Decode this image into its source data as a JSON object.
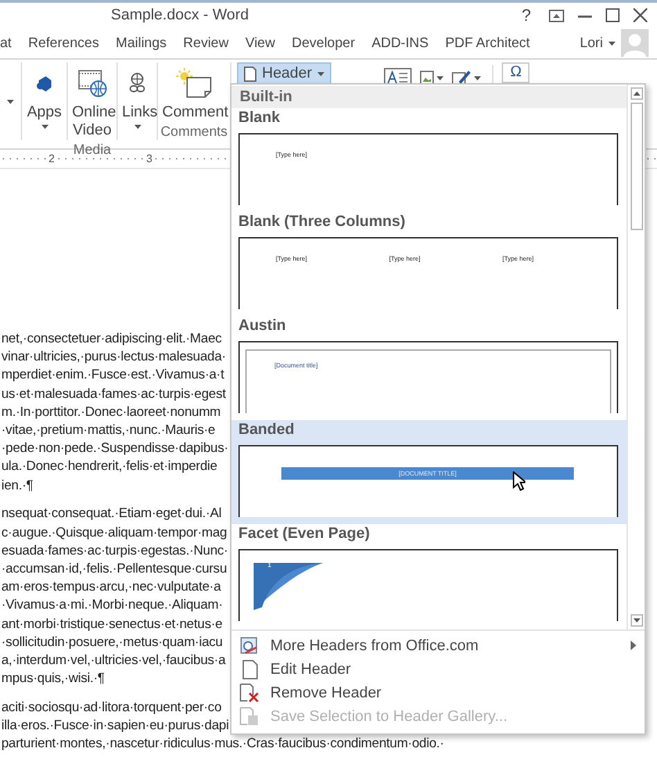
{
  "window": {
    "title": "Sample.docx - Word",
    "help": "?"
  },
  "tabs": [
    {
      "label": "at",
      "selected": false
    },
    {
      "label": "References",
      "selected": false
    },
    {
      "label": "Mailings",
      "selected": false
    },
    {
      "label": "Review",
      "selected": false
    },
    {
      "label": "View",
      "selected": false
    },
    {
      "label": "Developer",
      "selected": false
    },
    {
      "label": "ADD-INS",
      "selected": false
    },
    {
      "label": "PDF Architect",
      "selected": false
    }
  ],
  "account": {
    "name": "Lori"
  },
  "ribbon": {
    "groups": [
      {
        "buttons": [
          {
            "label": "Apps",
            "dropdown": true
          }
        ]
      },
      {
        "label": "Media",
        "buttons": [
          {
            "label": "Online Video",
            "dropdown": false
          }
        ]
      },
      {
        "buttons": [
          {
            "label": "Links",
            "dropdown": true
          }
        ]
      },
      {
        "label": "Comments",
        "buttons": [
          {
            "label": "Comment",
            "dropdown": false
          }
        ]
      }
    ],
    "header_button": {
      "label": "Header",
      "open": true
    },
    "symbol_button": {
      "label": "Ω"
    }
  },
  "ruler": {
    "marks": [
      "2",
      "3"
    ]
  },
  "document": {
    "paragraphs": [
      [
        "net,·consectetuer·adipiscing·elit.·Maec",
        "vinar·ultricies,·purus·lectus·malesuada·",
        "mperdiet·enim.·Fusce·est.·Vivamus·a·t",
        "us·et·malesuada·fames·ac·turpis·egest",
        "m.·In·porttitor.·Donec·laoreet·nonumm",
        "·vitae,·pretium·mattis,·nunc.·Mauris·e",
        "·pede·non·pede.·Suspendisse·dapibus·",
        "ula.·Donec·hendrerit,·felis·et·imperdie",
        "ien.·¶"
      ],
      [
        "nsequat·consequat.·Etiam·eget·dui.·Al",
        "c·augue.·Quisque·aliquam·tempor·mag",
        "esuada·fames·ac·turpis·egestas.·Nunc·",
        "·accumsan·id,·felis.·Pellentesque·cursu",
        "am·eros·tempus·arcu,·nec·vulputate·a",
        "·Vivamus·a·mi.·Morbi·neque.·Aliquam·",
        "ant·morbi·tristique·senectus·et·netus·e",
        "·sollicitudin·posuere,·metus·quam·iacu",
        "a,·interdum·vel,·ultricies·vel,·faucibus·a",
        "mpus·quis,·wisi.·¶"
      ],
      [
        "aciti·sociosqu·ad·litora·torquent·per·co",
        "illa·eros.·Fusce·in·sapien·eu·purus·dapi",
        "parturient·montes,·nascetur·ridiculus·mus.·Cras·faucibus·condimentum·odio.·"
      ]
    ]
  },
  "header_menu": {
    "section": "Built-in",
    "gallery": [
      {
        "name": "Blank",
        "kind": "blank",
        "selected": false,
        "placeholders": [
          "[Type here]"
        ]
      },
      {
        "name": "Blank (Three Columns)",
        "kind": "columns",
        "selected": false,
        "placeholders": [
          "[Type here]",
          "[Type here]",
          "[Type here]"
        ]
      },
      {
        "name": "Austin",
        "kind": "framed",
        "selected": false,
        "placeholders": [
          "[Document title]"
        ]
      },
      {
        "name": "Banded",
        "kind": "band",
        "selected": true,
        "placeholders": [
          "[DOCUMENT TITLE]"
        ]
      },
      {
        "name": "Facet (Even Page)",
        "kind": "facet",
        "selected": false,
        "placeholders": [
          "1"
        ]
      }
    ],
    "items": [
      {
        "label": "More Headers from Office.com",
        "disabled": false,
        "submenu": true
      },
      {
        "label": "Edit Header",
        "disabled": false,
        "submenu": false
      },
      {
        "label": "Remove Header",
        "disabled": false,
        "submenu": false
      },
      {
        "label": "Save Selection to Header Gallery...",
        "disabled": true,
        "submenu": false
      }
    ]
  }
}
